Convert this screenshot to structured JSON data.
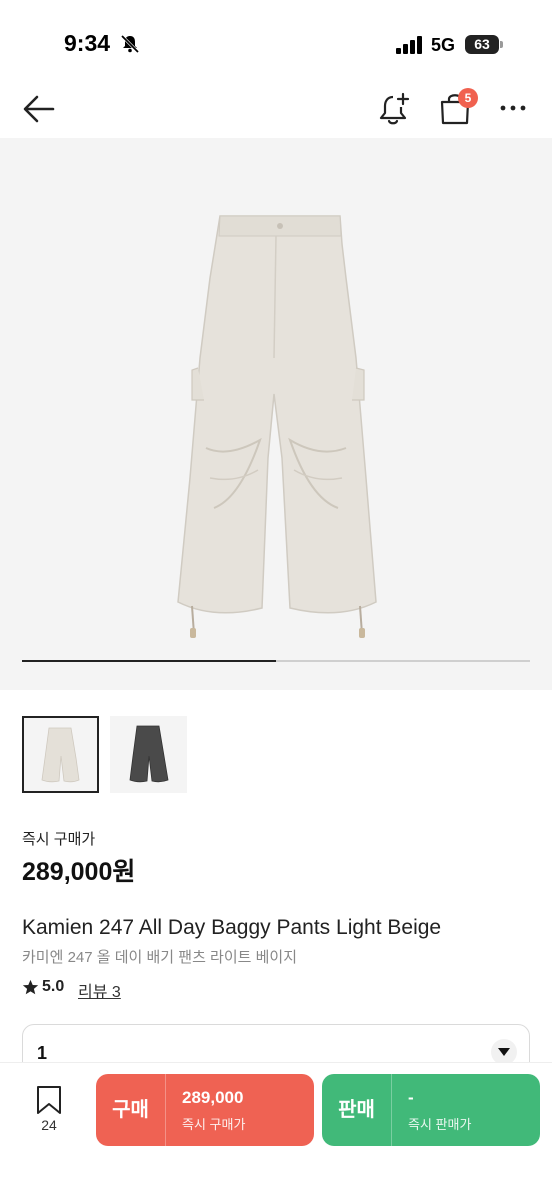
{
  "status_bar": {
    "time": "9:34",
    "network": "5G",
    "battery": "63",
    "icons": [
      "bell-slash-icon",
      "signal-bars-icon",
      "battery-icon"
    ]
  },
  "nav": {
    "icons": [
      "arrow-left-icon",
      "bell-plus-icon",
      "shopping-bag-icon",
      "more-horizontal-icon"
    ],
    "cart_count": "5"
  },
  "gallery": {
    "progress_fraction": 0.5,
    "thumbnail_count": 2
  },
  "product": {
    "price_label": "즉시 구매가",
    "price": "289,000원",
    "title_en": "Kamien 247 All Day Baggy Pants Light Beige",
    "title_ko": "카미엔 247 올 데이 배기 팬츠 라이트 베이지",
    "rating": "5.0",
    "review_link": "리뷰 3"
  },
  "size_selector": {
    "value": "1"
  },
  "bottom_bar": {
    "save_count": "24",
    "buy": {
      "label": "구매",
      "price": "289,000",
      "sub": "즉시 구매가",
      "color": "#ef6253"
    },
    "sell": {
      "label": "판매",
      "price": "-",
      "sub": "즉시 판매가",
      "color": "#41b979"
    }
  }
}
